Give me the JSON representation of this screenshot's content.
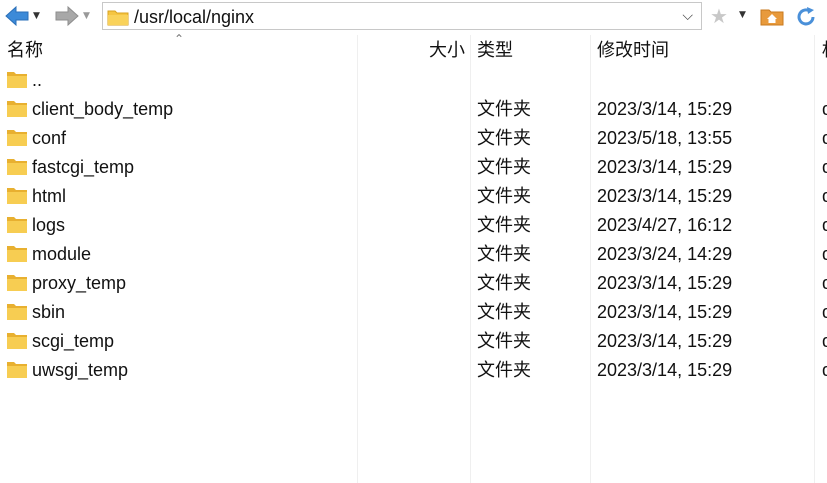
{
  "toolbar": {
    "back_icon": "back-arrow-icon",
    "forward_icon": "forward-arrow-icon",
    "address_path": "/usr/local/nginx",
    "bookmark_icon": "star-icon",
    "home_icon": "home-folder-icon",
    "refresh_icon": "refresh-icon",
    "colors": {
      "back_arrow": "#3c8ad8",
      "forward_arrow": "#9a9a9a",
      "folder": "#f5c542",
      "home": "#e89a3c",
      "refresh": "#4a90d9"
    }
  },
  "columns": {
    "name": "名称",
    "size": "大小",
    "type": "类型",
    "modified": "修改时间",
    "extra": "权"
  },
  "files": [
    {
      "name": "..",
      "size": "",
      "type": "",
      "modified": "",
      "extra": ""
    },
    {
      "name": "client_body_temp",
      "size": "",
      "type": "文件夹",
      "modified": "2023/3/14, 15:29",
      "extra": "d"
    },
    {
      "name": "conf",
      "size": "",
      "type": "文件夹",
      "modified": "2023/5/18, 13:55",
      "extra": "d"
    },
    {
      "name": "fastcgi_temp",
      "size": "",
      "type": "文件夹",
      "modified": "2023/3/14, 15:29",
      "extra": "d"
    },
    {
      "name": "html",
      "size": "",
      "type": "文件夹",
      "modified": "2023/3/14, 15:29",
      "extra": "d"
    },
    {
      "name": "logs",
      "size": "",
      "type": "文件夹",
      "modified": "2023/4/27, 16:12",
      "extra": "d"
    },
    {
      "name": "module",
      "size": "",
      "type": "文件夹",
      "modified": "2023/3/24, 14:29",
      "extra": "d"
    },
    {
      "name": "proxy_temp",
      "size": "",
      "type": "文件夹",
      "modified": "2023/3/14, 15:29",
      "extra": "d"
    },
    {
      "name": "sbin",
      "size": "",
      "type": "文件夹",
      "modified": "2023/3/14, 15:29",
      "extra": "d"
    },
    {
      "name": "scgi_temp",
      "size": "",
      "type": "文件夹",
      "modified": "2023/3/14, 15:29",
      "extra": "d"
    },
    {
      "name": "uwsgi_temp",
      "size": "",
      "type": "文件夹",
      "modified": "2023/3/14, 15:29",
      "extra": "d"
    }
  ]
}
